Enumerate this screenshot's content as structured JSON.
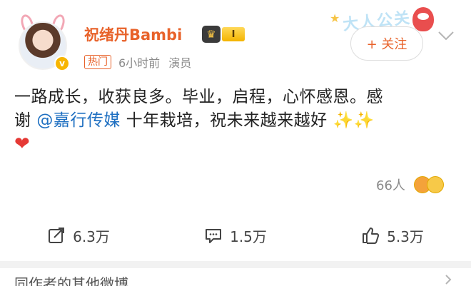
{
  "user": {
    "name": "祝绪丹Bambi",
    "level": "I",
    "verified_mark": "v"
  },
  "meta": {
    "hot_tag": "热门",
    "time": "6小时前",
    "role": "演员"
  },
  "header": {
    "follow_label": "+ 关注",
    "banner_text": "大人公关"
  },
  "post": {
    "line1": "一路成长，收获良多。毕业，启程，心怀感恩。感",
    "line2_prefix": "谢 ",
    "mention": "@嘉行传媒",
    "line2_suffix": " 十年栽培，祝未来越来越好 ",
    "sparkles": "✨✨",
    "heart": "❤"
  },
  "reactions": {
    "count": "66人"
  },
  "actions": {
    "repost": "6.3万",
    "comment": "1.5万",
    "like": "5.3万"
  },
  "related": {
    "title": "同作者的其他微博"
  },
  "colors": {
    "accent": "#e8622a",
    "mention": "#1e6fc1"
  }
}
